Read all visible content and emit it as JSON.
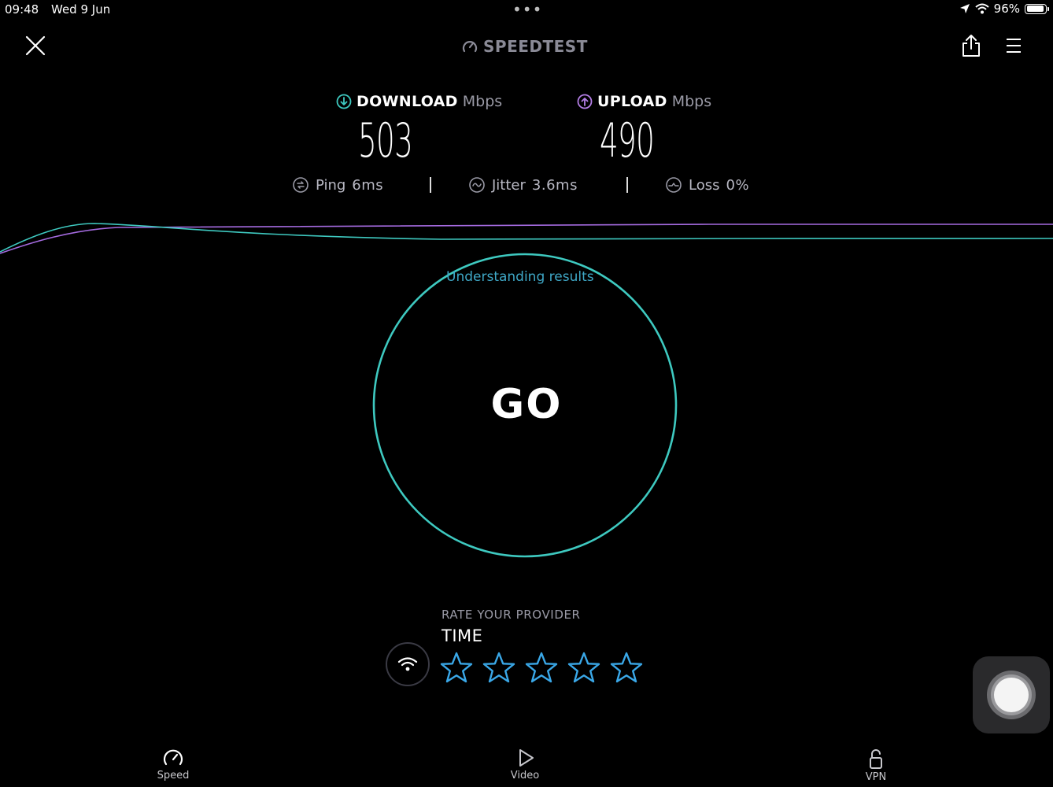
{
  "status_bar": {
    "time": "09:48",
    "date": "Wed 9 Jun",
    "battery": "96%",
    "battery_level": 0.96,
    "icons": [
      "location-icon",
      "wifi-icon",
      "battery-icon"
    ]
  },
  "header": {
    "brand": "SPEEDTEST",
    "close_icon": "close-icon",
    "share_icon": "share-icon",
    "menu_icon": "menu-icon"
  },
  "results": {
    "download": {
      "label": "DOWNLOAD",
      "unit": "Mbps",
      "value": "503",
      "color": "#3ec9c0"
    },
    "upload": {
      "label": "UPLOAD",
      "unit": "Mbps",
      "value": "490",
      "color": "#b47ee6"
    },
    "ping": {
      "label": "Ping",
      "value": "6",
      "unit": "ms"
    },
    "jitter": {
      "label": "Jitter",
      "value": "3.6",
      "unit": "ms"
    },
    "loss": {
      "label": "Loss",
      "value": "0",
      "unit": "%"
    }
  },
  "graph": {
    "download_color": "#3ec9c0",
    "upload_color": "#a56be0"
  },
  "go": {
    "label": "GO",
    "link": "Understanding results",
    "ring_color": "#3ec9c0"
  },
  "rating": {
    "title": "RATE YOUR PROVIDER",
    "provider": "TIME",
    "star_count": 5,
    "star_color": "#3aa8e8"
  },
  "tabs": [
    {
      "label": "Speed",
      "icon": "speedometer-icon"
    },
    {
      "label": "Video",
      "icon": "play-icon"
    },
    {
      "label": "VPN",
      "icon": "unlock-icon"
    }
  ]
}
